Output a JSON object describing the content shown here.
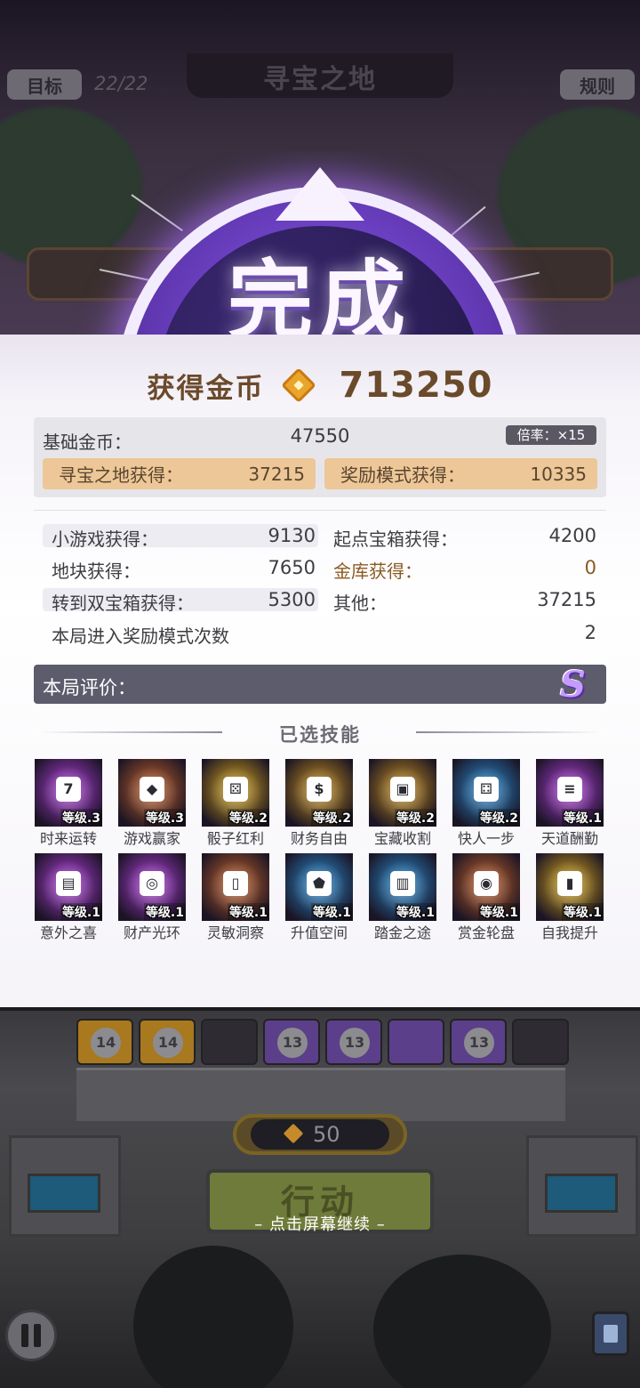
{
  "top_bar": {
    "goal_label": "目标",
    "goal_progress": "22/22",
    "title": "寻宝之地",
    "rules_label": "规则"
  },
  "badge": {
    "text": "完成"
  },
  "reward": {
    "label": "获得金币",
    "total": "713250",
    "coin_icon": "coin-icon"
  },
  "base": {
    "label": "基础金币：",
    "value": "47550",
    "multiplier": "倍率：×15",
    "breakdown": [
      {
        "label": "寻宝之地获得：",
        "value": "37215"
      },
      {
        "label": "奖励模式获得：",
        "value": "10335"
      }
    ]
  },
  "stats": [
    {
      "label": "小游戏获得：",
      "value": "9130"
    },
    {
      "label": "起点宝箱获得：",
      "value": "4200"
    },
    {
      "label": "地块获得：",
      "value": "7650"
    },
    {
      "label": "金库获得：",
      "value": "0"
    },
    {
      "label": "转到双宝箱获得：",
      "value": "5300"
    },
    {
      "label": "其他：",
      "value": "37215"
    }
  ],
  "bonus_entries": {
    "label": "本局进入奖励模式次数",
    "value": "2"
  },
  "rating": {
    "label": "本局评价：",
    "grade": "S"
  },
  "skills_title": "已选技能",
  "skills": [
    {
      "name": "时来运转",
      "level": "等级.3",
      "icon": "lucky-seven-icon",
      "color": "#b43fe0"
    },
    {
      "name": "游戏赢家",
      "level": "等级.3",
      "icon": "diamond-icon",
      "color": "#c5632a"
    },
    {
      "name": "骰子红利",
      "level": "等级.2",
      "icon": "dice-icon",
      "color": "#d9a81c"
    },
    {
      "name": "财务自由",
      "level": "等级.2",
      "icon": "money-bag-icon",
      "color": "#c9921e"
    },
    {
      "name": "宝藏收割",
      "level": "等级.2",
      "icon": "treasure-chest-icon",
      "color": "#c9921e"
    },
    {
      "name": "快人一步",
      "level": "等级.2",
      "icon": "dice-step-icon",
      "color": "#2a8fd6"
    },
    {
      "name": "天道酬勤",
      "level": "等级.1",
      "icon": "coin-stack-icon",
      "color": "#b43fe0"
    },
    {
      "name": "意外之喜",
      "level": "等级.1",
      "icon": "gift-chest-icon",
      "color": "#b43fe0"
    },
    {
      "name": "财产光环",
      "level": "等级.1",
      "icon": "coin-aura-icon",
      "color": "#b43fe0"
    },
    {
      "name": "灵敏洞察",
      "level": "等级.1",
      "icon": "cards-icon",
      "color": "#c5632a"
    },
    {
      "name": "升值空间",
      "level": "等级.1",
      "icon": "gem-up-icon",
      "color": "#2a8fd6"
    },
    {
      "name": "踏金之途",
      "level": "等级.1",
      "icon": "gold-path-icon",
      "color": "#2a8fd6"
    },
    {
      "name": "赏金轮盘",
      "level": "等级.1",
      "icon": "roulette-icon",
      "color": "#c5632a"
    },
    {
      "name": "自我提升",
      "level": "等级.1",
      "icon": "card-up-icon",
      "color": "#d9a81c"
    }
  ],
  "bottom": {
    "action_cost": "50",
    "action_label": "行动",
    "continue_hint": "– 点击屏幕继续 –",
    "tiles": [
      "14",
      "14",
      "",
      "13",
      "13",
      "",
      "13",
      ""
    ]
  }
}
